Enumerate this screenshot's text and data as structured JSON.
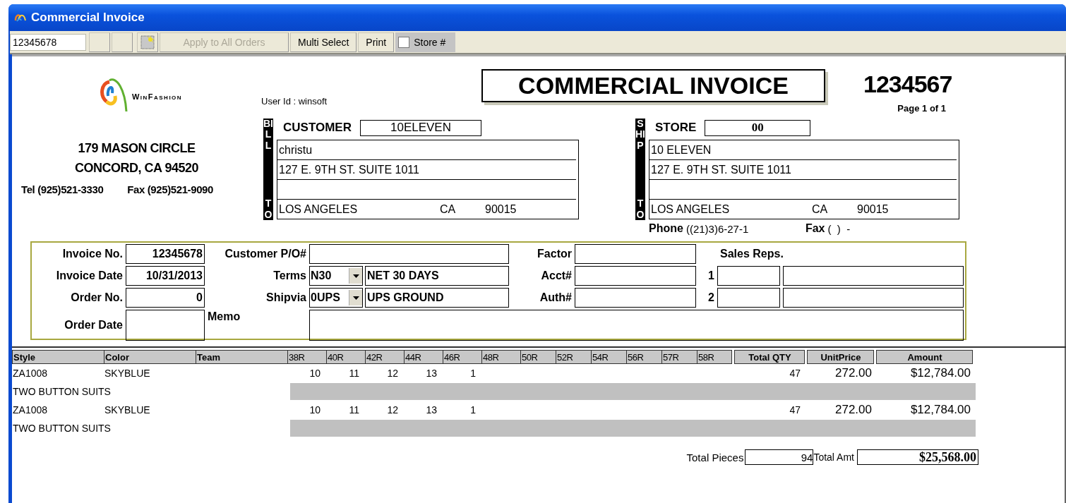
{
  "window": {
    "title": "Commercial Invoice"
  },
  "toolbar": {
    "order_field": "12345678",
    "buttons": [
      {
        "kind": "blank"
      },
      {
        "kind": "blank"
      },
      {
        "kind": "icon"
      },
      {
        "kind": "text",
        "label": "Apply to All Orders",
        "disabled": true
      },
      {
        "kind": "text",
        "label": "Multi Select",
        "disabled": false
      },
      {
        "kind": "text",
        "label": "Print",
        "disabled": false
      }
    ],
    "store_checkbox": {
      "label": "Store #",
      "checked": false
    }
  },
  "company": {
    "logo_text": "WinFashion",
    "address_lines": [
      "179 MASON CIRCLE",
      "CONCORD, CA 94520"
    ],
    "tel": "Tel (925)521-3330",
    "fax": "Fax (925)521-9090"
  },
  "user_id": "User Id : winsoft",
  "document_title": "COMMERCIAL INVOICE",
  "invoice_number": "1234567",
  "page": "Page 1 of 1",
  "parties": [
    {
      "side_label": [
        "BILL",
        "TO"
      ],
      "label": "CUSTOMER",
      "code": "10ELEVEN",
      "lines": [
        "christu",
        "127 E. 9TH ST. SUITE 1011"
      ],
      "city": "LOS ANGELES",
      "state": "CA",
      "zip": "90015"
    },
    {
      "side_label": [
        "SHIP",
        "TO"
      ],
      "label": "STORE",
      "code": "00",
      "lines": [
        "10 ELEVEN",
        "127 E. 9TH ST. SUITE 1011"
      ],
      "city": "LOS ANGELES",
      "state": "CA",
      "zip": "90015",
      "phone_label": "Phone",
      "phone": "((21)3)6-27-1",
      "fax_label": "Fax",
      "fax": "(  )  -"
    }
  ],
  "order_info": {
    "left_fields": [
      {
        "label": "Invoice No.",
        "value": "12345678"
      },
      {
        "label": "Invoice Date",
        "value": "10/31/2013"
      },
      {
        "label": "Order No.",
        "value": "0"
      },
      {
        "label": "Order Date"
      }
    ],
    "customer_po": {
      "label": "Customer P/O#"
    },
    "terms": {
      "label": "Terms",
      "code": "N30",
      "description": "NET 30 DAYS"
    },
    "shipvia": {
      "label": "Shipvia",
      "code": "0UPS",
      "description": "UPS GROUND"
    },
    "memo": {
      "label": "Memo"
    },
    "right_fields": [
      {
        "label": "Factor"
      },
      {
        "label": "Acct#"
      },
      {
        "label": "Auth#"
      }
    ],
    "sales_reps": {
      "label": "Sales Reps.",
      "rows": [
        {
          "number": "1"
        },
        {
          "number": "2"
        }
      ]
    }
  },
  "table": {
    "columns": [
      "Style",
      "Color",
      "Team"
    ],
    "sizes": [
      "38R",
      "40R",
      "42R",
      "44R",
      "46R",
      "48R",
      "50R",
      "52R",
      "54R",
      "56R",
      "57R",
      "58R"
    ],
    "total_columns": [
      "Total QTY",
      "UnitPrice",
      "Amount"
    ],
    "rows": [
      {
        "style": "ZA1008",
        "color_name": "SKYBLUE",
        "quantities": [
          "10",
          "11",
          "12",
          "13",
          "1"
        ],
        "total_qty": "47",
        "unit_price": "272.00",
        "amount": "$12,784.00",
        "description": "TWO BUTTON SUITS"
      },
      {
        "style": "ZA1008",
        "color_name": "SKYBLUE",
        "quantities": [
          "10",
          "11",
          "12",
          "13",
          "1"
        ],
        "total_qty": "47",
        "unit_price": "272.00",
        "amount": "$12,784.00",
        "description": "TWO BUTTON SUITS"
      }
    ],
    "footer": {
      "pieces_label": "Total Pieces",
      "pieces": "94",
      "amount_label": "Total Amt",
      "amount": "$25,568.00"
    }
  }
}
